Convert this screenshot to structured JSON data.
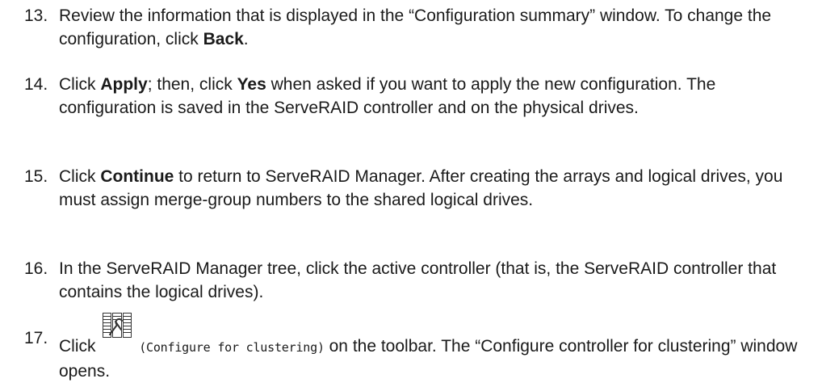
{
  "steps": [
    {
      "number": "13.",
      "parts": [
        {
          "text": "Review the information that is displayed in the “Configuration summary” window. To change the configuration, click ",
          "bold": false
        },
        {
          "text": "Back",
          "bold": true
        },
        {
          "text": ".",
          "bold": false
        }
      ]
    },
    {
      "number": "14.",
      "parts": [
        {
          "text": "Click ",
          "bold": false
        },
        {
          "text": "Apply",
          "bold": true
        },
        {
          "text": "; then, click ",
          "bold": false
        },
        {
          "text": "Yes",
          "bold": true
        },
        {
          "text": " when asked if you want to apply the new configuration. The configuration is saved in the ServeRAID controller and on the physical drives.",
          "bold": false
        }
      ]
    },
    {
      "number": "15.",
      "parts": [
        {
          "text": "Click ",
          "bold": false
        },
        {
          "text": "Continue",
          "bold": true
        },
        {
          "text": " to return to ServeRAID Manager. After creating the arrays and logical drives, you must assign merge-group numbers to the shared logical drives.",
          "bold": false
        }
      ]
    },
    {
      "number": "16.",
      "parts": [
        {
          "text": "In the ServeRAID Manager tree, click the active controller (that is, the ServeRAID controller that contains the logical drives).",
          "bold": false
        }
      ]
    },
    {
      "number": "17.",
      "click_text": "Click",
      "icon": "configure-for-clustering-icon",
      "icon_caption": "(Configure for clustering)",
      "after_text": " on the toolbar. The “Configure controller for clustering” window opens."
    }
  ]
}
